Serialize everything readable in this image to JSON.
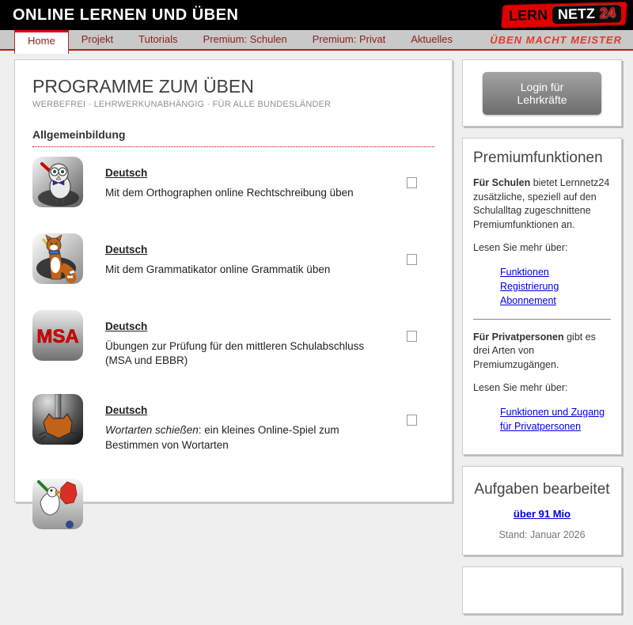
{
  "colors": {
    "accent_red": "#e10000",
    "nav_text_red": "#8c2020",
    "link_blue": "#0000e0",
    "slogan_red": "#e2392b"
  },
  "header": {
    "title": "ONLINE LERNEN UND ÜBEN",
    "logo": {
      "lern": "LERN",
      "netz": "NETZ",
      "num": "24"
    }
  },
  "nav": {
    "tabs": [
      {
        "label": "Home",
        "active": true
      },
      {
        "label": "Projekt",
        "active": false
      },
      {
        "label": "Tutorials",
        "active": false
      },
      {
        "label": "Premium: Schulen",
        "active": false
      },
      {
        "label": "Premium: Privat",
        "active": false
      },
      {
        "label": "Aktuelles",
        "active": false
      }
    ],
    "slogan": "ÜBEN MACHT MEISTER"
  },
  "main": {
    "title": "PROGRAMME ZUM ÜBEN",
    "subtitle": "WERBEFREI · LEHRWERKUNABHÄNGIG · FÜR ALLE BUNDESLÄNDER",
    "section": "Allgemeinbildung",
    "programs": [
      {
        "subject": "Deutsch",
        "desc": "Mit dem Orthographen online Rechtschreibung üben",
        "icon": "owl-with-red-pen-icon"
      },
      {
        "subject": "Deutsch",
        "desc": "Mit dem Grammatikator online Grammatik üben",
        "icon": "cat-with-pencil-icon"
      },
      {
        "subject": "Deutsch",
        "desc": "Übungen zur Prüfung für den mittleren Schulabschluss (MSA und EBBR)",
        "icon": "msa-badge-icon",
        "icon_text": "MSA"
      },
      {
        "subject": "Deutsch",
        "desc_italic": "Wortarten schießen",
        "desc": ": ein kleines Online-Spiel zum Bestimmen von Wortarten",
        "icon": "cat-head-shooting-icon"
      },
      {
        "icon": "goose-germany-map-icon"
      }
    ]
  },
  "sidebar": {
    "login_button": "Login für Lehrkräfte",
    "premium": {
      "title": "Premiumfunktionen",
      "schools_bold": "Für Schulen",
      "schools_text": " bietet Lernnetz24 zusätzliche, speziell auf den Schulalltag zugeschnittene Premiumfunktionen an.",
      "read_more_1": "Lesen Sie mehr über:",
      "school_links": [
        "Funktionen",
        "Registrierung",
        "Abonnement"
      ],
      "private_bold": "Für Privatpersonen",
      "private_text": " gibt es drei Arten von Premiumzugängen.",
      "read_more_2": "Lesen Sie mehr über:",
      "private_link": "Funktionen und Zugang für Privatpersonen"
    },
    "tasks": {
      "title": "Aufgaben bearbeitet",
      "count_link": "über 91 Mio",
      "stand": "Stand: Januar 2026"
    }
  }
}
